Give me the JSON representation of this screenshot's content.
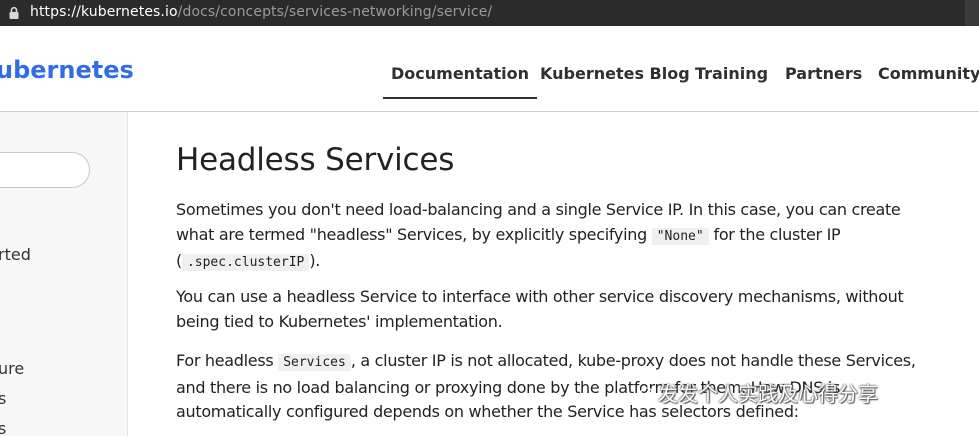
{
  "browser": {
    "url_host": "https://kubernetes.io",
    "url_path": "/docs/concepts/services-networking/service/"
  },
  "site": {
    "logo_text": "ubernetes",
    "brand_color": "#326ce5"
  },
  "nav": {
    "items": [
      {
        "label": "Documentation",
        "active": true
      },
      {
        "label": "Kubernetes Blog"
      },
      {
        "label": "Training"
      },
      {
        "label": "Partners"
      },
      {
        "label": "Community"
      }
    ]
  },
  "sidebar": {
    "search_placeholder": "",
    "items": [
      "rted",
      "ure",
      "s",
      "s"
    ]
  },
  "content": {
    "title": "Headless Services",
    "p1": {
      "t1": "Sometimes you don't need load-balancing and a single Service IP. In this case, you can create what are termed \"headless\" Services, by explicitly specifying ",
      "code1": "\"None\"",
      "t2": " for the cluster IP (",
      "code2": ".spec.clusterIP",
      "t3": ")."
    },
    "p2": "You can use a headless Service to interface with other service discovery mechanisms, without being tied to Kubernetes' implementation.",
    "p3": {
      "t1": "For headless ",
      "code1": "Services",
      "t2": ", a cluster IP is not allocated, kube-proxy does not handle these Services, and there is no load balancing or proxying done by the platform for them. How DNS is automatically configured depends on whether the Service has selectors defined:"
    }
  },
  "watermark": {
    "text": "发发个人实践及心得分享",
    "icon": "wechat-icon"
  }
}
